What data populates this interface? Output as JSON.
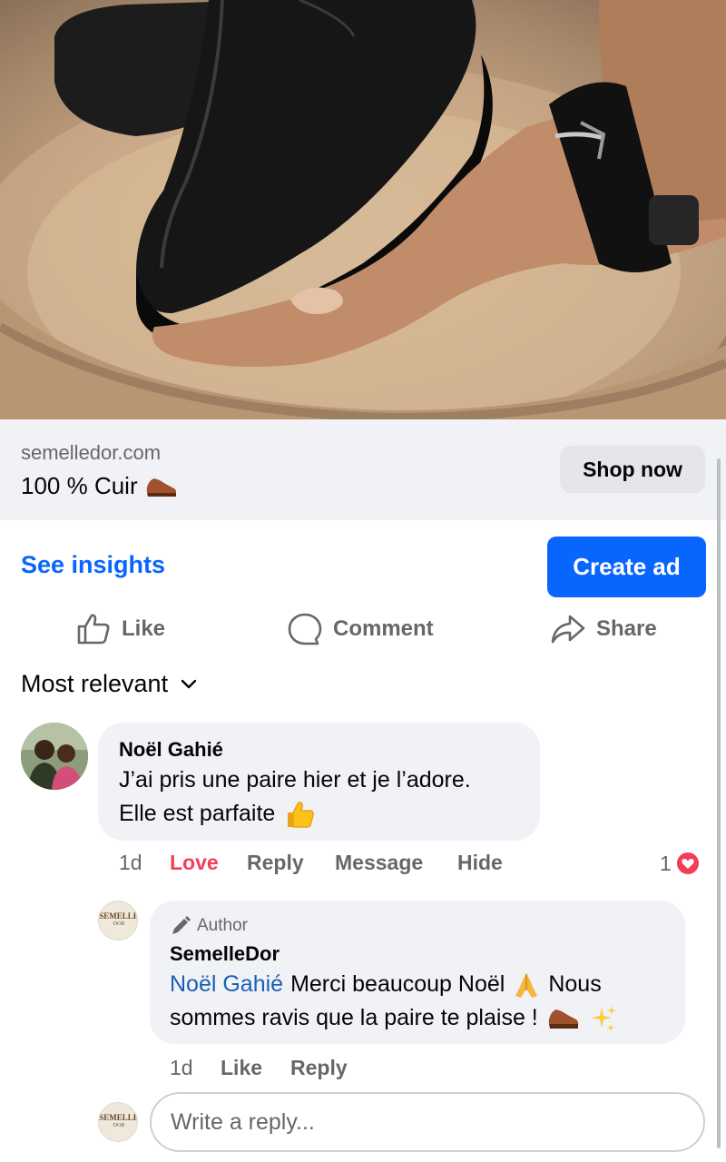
{
  "post": {
    "link_domain": "semelledor.com",
    "link_title": "100 % Cuir",
    "shop_button": "Shop now"
  },
  "insights": {
    "see_insights": "See insights",
    "create_ad": "Create ad"
  },
  "actions": {
    "like": "Like",
    "comment": "Comment",
    "share": "Share"
  },
  "sort": {
    "label": "Most relevant"
  },
  "comments": [
    {
      "author": "Noël Gahié",
      "text_line1": "J’ai pris une paire hier et je l’adore.",
      "text_line2": "Elle est parfaite",
      "time": "1d",
      "reaction_link": "Love",
      "reply": "Reply",
      "message": "Message",
      "hide": "Hide",
      "reaction_count": "1",
      "reply_item": {
        "badge": "Author",
        "author": "SemelleDor",
        "mention": "Noël Gahié",
        "text_part1": "Merci beaucoup Noël",
        "text_part2": "Nous",
        "text_line2": "sommes ravis que la paire te plaise !",
        "time": "1d",
        "like": "Like",
        "reply": "Reply"
      }
    }
  ],
  "reply_input": {
    "placeholder": "Write a reply..."
  },
  "logo": {
    "line1": "SEMELLE",
    "line2": "DOR"
  },
  "colors": {
    "accent": "#0866ff",
    "love": "#f33e58",
    "muted": "#65676b",
    "bubble": "#f0f2f5"
  },
  "icons": [
    "thumbs-up-icon",
    "comment-icon",
    "share-icon",
    "chevron-down-icon",
    "pencil-icon",
    "heart-icon",
    "shoe-emoji",
    "thumbs-up-emoji",
    "pray-emoji",
    "sparkles-emoji"
  ]
}
